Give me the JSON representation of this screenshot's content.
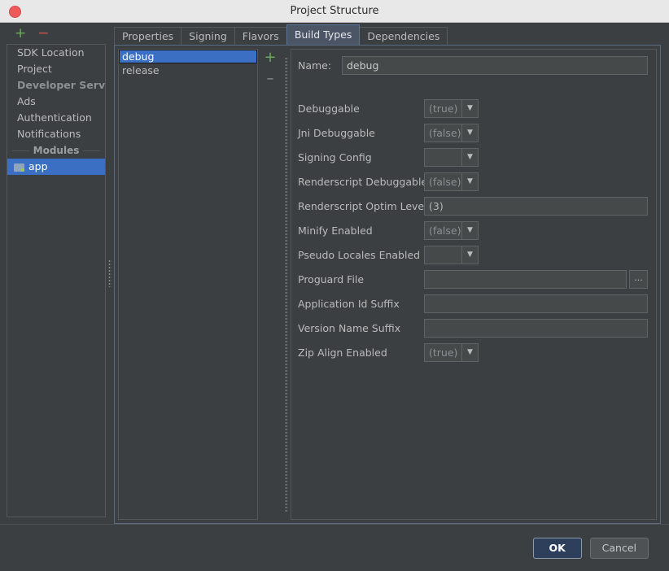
{
  "window": {
    "title": "Project Structure",
    "close_icon": "close-circle-icon"
  },
  "left_nav": {
    "add_icon": "plus-icon",
    "remove_icon": "minus-icon",
    "items": [
      {
        "label": "SDK Location",
        "style": "normal"
      },
      {
        "label": "Project",
        "style": "normal"
      },
      {
        "label": "Developer Servic...",
        "style": "dim"
      },
      {
        "label": "Ads",
        "style": "normal"
      },
      {
        "label": "Authentication",
        "style": "normal"
      },
      {
        "label": "Notifications",
        "style": "normal"
      }
    ],
    "group_separator": "Modules",
    "selected_module": "app",
    "module_icon": "folder-icon"
  },
  "tabs": [
    {
      "label": "Properties",
      "active": false
    },
    {
      "label": "Signing",
      "active": false
    },
    {
      "label": "Flavors",
      "active": false
    },
    {
      "label": "Build Types",
      "active": true
    },
    {
      "label": "Dependencies",
      "active": false
    }
  ],
  "build_types": {
    "items": [
      "debug",
      "release"
    ],
    "selected": "debug",
    "add_label": "+",
    "remove_label": "–"
  },
  "form": {
    "name_label": "Name:",
    "name_value": "debug",
    "browse_label": "...",
    "fields": [
      {
        "label": "Debuggable",
        "type": "combo",
        "value": "(true)"
      },
      {
        "label": "Jni Debuggable",
        "type": "combo",
        "value": "(false)"
      },
      {
        "label": "Signing Config",
        "type": "combo",
        "value": ""
      },
      {
        "label": "Renderscript Debuggable",
        "type": "combo",
        "value": "(false)"
      },
      {
        "label": "Renderscript Optim Level",
        "type": "text",
        "value": "(3)"
      },
      {
        "label": "Minify Enabled",
        "type": "combo",
        "value": "(false)"
      },
      {
        "label": "Pseudo Locales Enabled",
        "type": "combo",
        "value": ""
      },
      {
        "label": "Proguard File",
        "type": "browse",
        "value": ""
      },
      {
        "label": "Application Id Suffix",
        "type": "text",
        "value": ""
      },
      {
        "label": "Version Name Suffix",
        "type": "text",
        "value": ""
      },
      {
        "label": "Zip Align Enabled",
        "type": "combo",
        "value": "(true)"
      }
    ]
  },
  "footer": {
    "ok_label": "OK",
    "cancel_label": "Cancel"
  }
}
